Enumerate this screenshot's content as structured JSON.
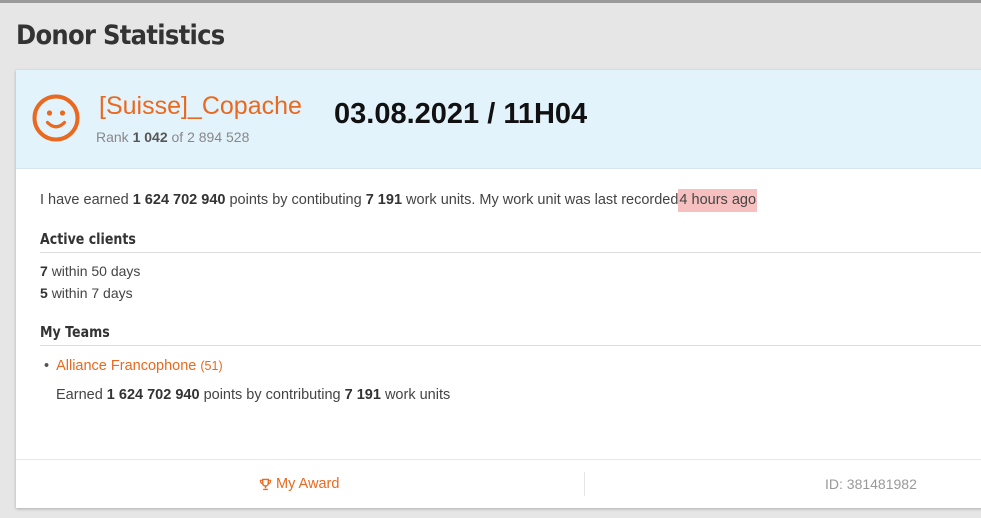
{
  "page": {
    "title": "Donor Statistics"
  },
  "donor": {
    "name": "[Suisse]_Copache",
    "rank_label": "Rank",
    "rank": "1 042",
    "rank_of": "of",
    "rank_total": "2 894 528",
    "datetime": "03.08.2021 / 11H04",
    "avatar_icon": "smiley-face-icon"
  },
  "summary": {
    "prefix": "I have earned",
    "points": "1 624 702 940",
    "mid1": "points by contibuting",
    "work_units": "7 191",
    "mid2": "work units. My work unit was last recorded",
    "last_recorded": "4 hours ago"
  },
  "active_clients": {
    "title": "Active clients",
    "rows": [
      {
        "count": "7",
        "text": "within 50 days"
      },
      {
        "count": "5",
        "text": "within 7 days"
      }
    ]
  },
  "teams": {
    "title": "My Teams",
    "items": [
      {
        "name": "Alliance Francophone",
        "count": "(51)",
        "earned_prefix": "Earned",
        "points": "1 624 702 940",
        "mid": "points by contributing",
        "work_units": "7 191",
        "suffix": "work units"
      }
    ]
  },
  "footer": {
    "award_label": "My Award",
    "award_icon": "trophy-icon",
    "id_label": "ID: 381481982"
  },
  "colors": {
    "accent": "#e8691f",
    "header_bg": "#e3f3fb",
    "highlight": "#f6c0c0",
    "page_bg": "#e6e6e6"
  }
}
